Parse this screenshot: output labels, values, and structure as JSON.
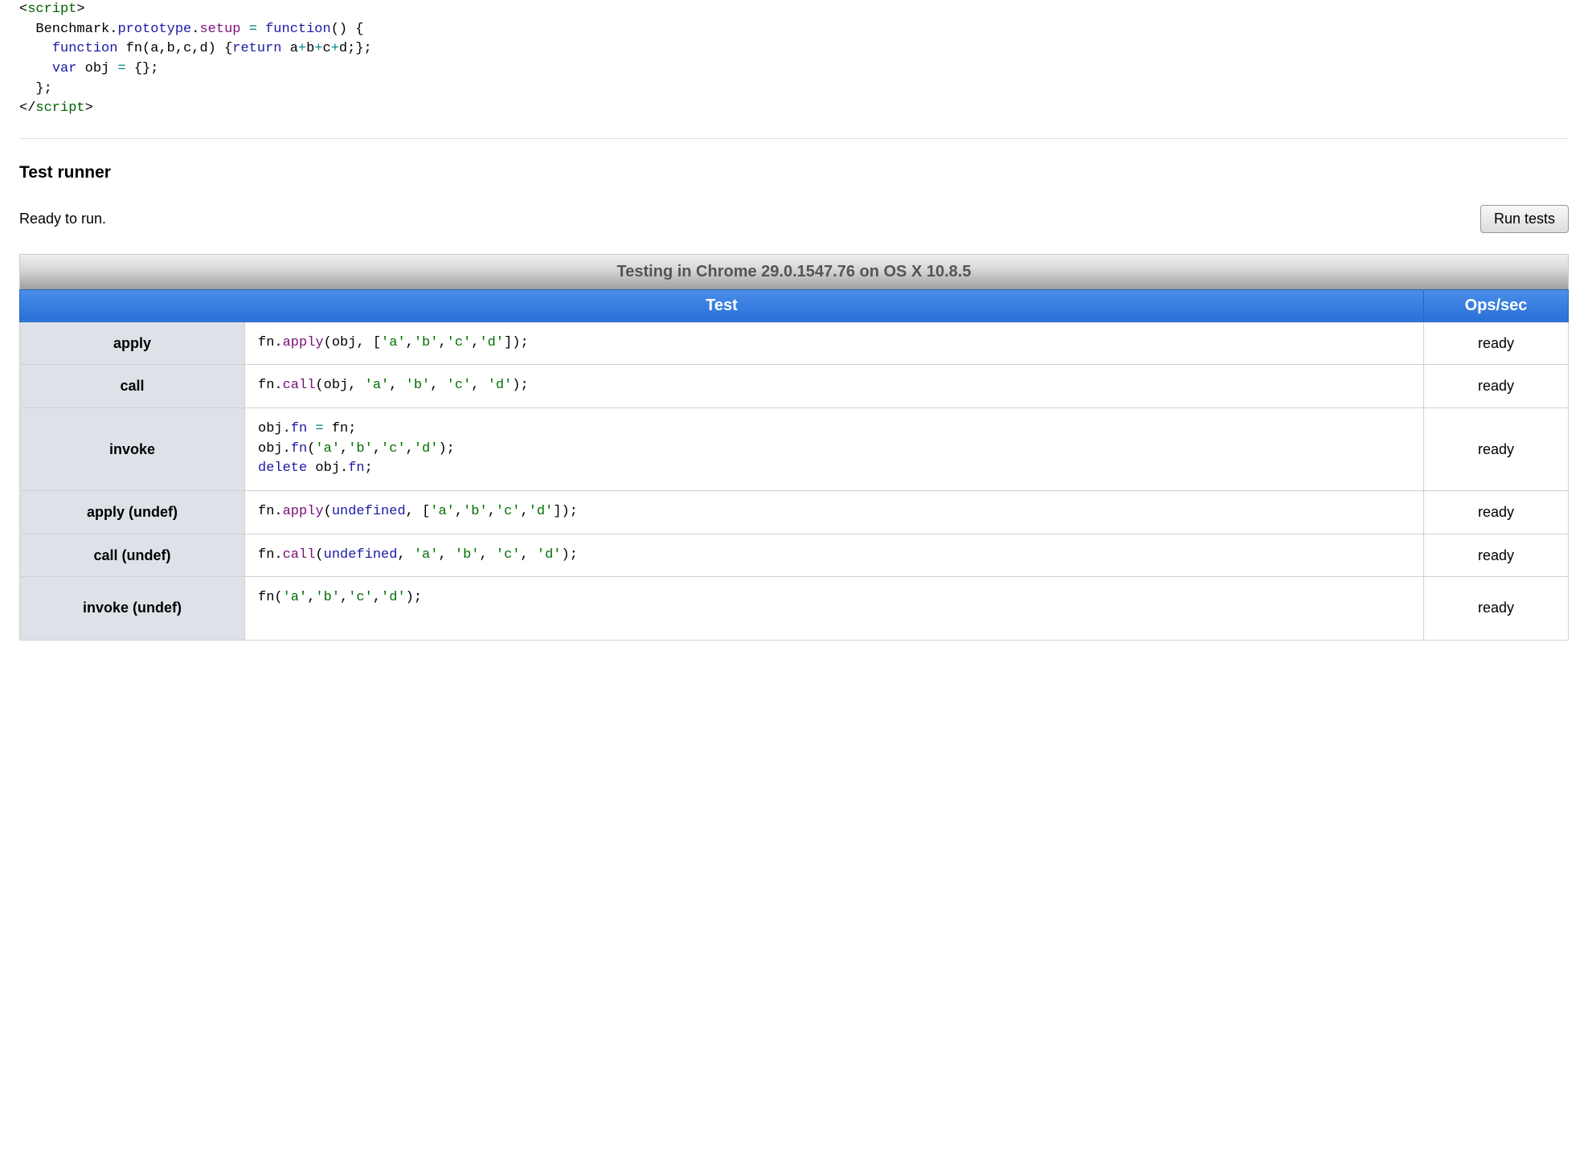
{
  "setup": {
    "tokens": [
      {
        "t": "punc",
        "v": "<"
      },
      {
        "t": "tag",
        "v": "script"
      },
      {
        "t": "punc",
        "v": ">"
      },
      {
        "t": "nl"
      },
      {
        "t": "sp",
        "v": "  "
      },
      {
        "t": "ident",
        "v": "Benchmark"
      },
      {
        "t": "punc",
        "v": "."
      },
      {
        "t": "member1",
        "v": "prototype"
      },
      {
        "t": "punc",
        "v": "."
      },
      {
        "t": "member2",
        "v": "setup"
      },
      {
        "t": "plain",
        "v": " "
      },
      {
        "t": "op",
        "v": "="
      },
      {
        "t": "plain",
        "v": " "
      },
      {
        "t": "kw",
        "v": "function"
      },
      {
        "t": "punc",
        "v": "()"
      },
      {
        "t": "plain",
        "v": " "
      },
      {
        "t": "punc",
        "v": "{"
      },
      {
        "t": "nl"
      },
      {
        "t": "sp",
        "v": "    "
      },
      {
        "t": "kw",
        "v": "function"
      },
      {
        "t": "plain",
        "v": " fn"
      },
      {
        "t": "punc",
        "v": "("
      },
      {
        "t": "plain",
        "v": "a"
      },
      {
        "t": "punc",
        "v": ","
      },
      {
        "t": "plain",
        "v": "b"
      },
      {
        "t": "punc",
        "v": ","
      },
      {
        "t": "plain",
        "v": "c"
      },
      {
        "t": "punc",
        "v": ","
      },
      {
        "t": "plain",
        "v": "d"
      },
      {
        "t": "punc",
        "v": ")"
      },
      {
        "t": "plain",
        "v": " "
      },
      {
        "t": "punc",
        "v": "{"
      },
      {
        "t": "kw",
        "v": "return"
      },
      {
        "t": "plain",
        "v": " a"
      },
      {
        "t": "op",
        "v": "+"
      },
      {
        "t": "plain",
        "v": "b"
      },
      {
        "t": "op",
        "v": "+"
      },
      {
        "t": "plain",
        "v": "c"
      },
      {
        "t": "op",
        "v": "+"
      },
      {
        "t": "plain",
        "v": "d"
      },
      {
        "t": "punc",
        "v": ";"
      },
      {
        "t": "punc",
        "v": "}"
      },
      {
        "t": "punc",
        "v": ";"
      },
      {
        "t": "nl"
      },
      {
        "t": "sp",
        "v": "    "
      },
      {
        "t": "kw",
        "v": "var"
      },
      {
        "t": "plain",
        "v": " obj "
      },
      {
        "t": "op",
        "v": "="
      },
      {
        "t": "plain",
        "v": " "
      },
      {
        "t": "punc",
        "v": "{};"
      },
      {
        "t": "nl"
      },
      {
        "t": "sp",
        "v": "  "
      },
      {
        "t": "punc",
        "v": "};"
      },
      {
        "t": "nl"
      },
      {
        "t": "punc",
        "v": "</"
      },
      {
        "t": "tag",
        "v": "script"
      },
      {
        "t": "punc",
        "v": ">"
      }
    ]
  },
  "section_heading": "Test runner",
  "status_text": "Ready to run.",
  "run_button_label": "Run tests",
  "table": {
    "caption": "Testing in Chrome 29.0.1547.76 on OS X 10.8.5",
    "columns": [
      "Test",
      "Ops/sec"
    ],
    "rows": [
      {
        "name": "apply",
        "ops": "ready",
        "tokens": [
          {
            "t": "plain",
            "v": "fn"
          },
          {
            "t": "punc",
            "v": "."
          },
          {
            "t": "member2",
            "v": "apply"
          },
          {
            "t": "punc",
            "v": "("
          },
          {
            "t": "plain",
            "v": "obj"
          },
          {
            "t": "punc",
            "v": ", "
          },
          {
            "t": "punc",
            "v": "["
          },
          {
            "t": "str",
            "v": "'a'"
          },
          {
            "t": "punc",
            "v": ","
          },
          {
            "t": "str",
            "v": "'b'"
          },
          {
            "t": "punc",
            "v": ","
          },
          {
            "t": "str",
            "v": "'c'"
          },
          {
            "t": "punc",
            "v": ","
          },
          {
            "t": "str",
            "v": "'d'"
          },
          {
            "t": "punc",
            "v": "]"
          },
          {
            "t": "punc",
            "v": ");"
          }
        ]
      },
      {
        "name": "call",
        "ops": "ready",
        "tokens": [
          {
            "t": "plain",
            "v": "fn"
          },
          {
            "t": "punc",
            "v": "."
          },
          {
            "t": "member2",
            "v": "call"
          },
          {
            "t": "punc",
            "v": "("
          },
          {
            "t": "plain",
            "v": "obj"
          },
          {
            "t": "punc",
            "v": ", "
          },
          {
            "t": "str",
            "v": "'a'"
          },
          {
            "t": "punc",
            "v": ", "
          },
          {
            "t": "str",
            "v": "'b'"
          },
          {
            "t": "punc",
            "v": ", "
          },
          {
            "t": "str",
            "v": "'c'"
          },
          {
            "t": "punc",
            "v": ", "
          },
          {
            "t": "str",
            "v": "'d'"
          },
          {
            "t": "punc",
            "v": ");"
          }
        ]
      },
      {
        "name": "invoke",
        "ops": "ready",
        "tokens": [
          {
            "t": "plain",
            "v": "obj"
          },
          {
            "t": "punc",
            "v": "."
          },
          {
            "t": "member1",
            "v": "fn"
          },
          {
            "t": "plain",
            "v": " "
          },
          {
            "t": "op",
            "v": "="
          },
          {
            "t": "plain",
            "v": " fn"
          },
          {
            "t": "punc",
            "v": ";"
          },
          {
            "t": "nl"
          },
          {
            "t": "plain",
            "v": "obj"
          },
          {
            "t": "punc",
            "v": "."
          },
          {
            "t": "member1",
            "v": "fn"
          },
          {
            "t": "punc",
            "v": "("
          },
          {
            "t": "str",
            "v": "'a'"
          },
          {
            "t": "punc",
            "v": ","
          },
          {
            "t": "str",
            "v": "'b'"
          },
          {
            "t": "punc",
            "v": ","
          },
          {
            "t": "str",
            "v": "'c'"
          },
          {
            "t": "punc",
            "v": ","
          },
          {
            "t": "str",
            "v": "'d'"
          },
          {
            "t": "punc",
            "v": ");"
          },
          {
            "t": "nl"
          },
          {
            "t": "kw",
            "v": "delete"
          },
          {
            "t": "plain",
            "v": " obj"
          },
          {
            "t": "punc",
            "v": "."
          },
          {
            "t": "member1",
            "v": "fn"
          },
          {
            "t": "punc",
            "v": ";"
          }
        ]
      },
      {
        "name": "apply (undef)",
        "ops": "ready",
        "tokens": [
          {
            "t": "plain",
            "v": "fn"
          },
          {
            "t": "punc",
            "v": "."
          },
          {
            "t": "member2",
            "v": "apply"
          },
          {
            "t": "punc",
            "v": "("
          },
          {
            "t": "kw",
            "v": "undefined"
          },
          {
            "t": "punc",
            "v": ", "
          },
          {
            "t": "punc",
            "v": "["
          },
          {
            "t": "str",
            "v": "'a'"
          },
          {
            "t": "punc",
            "v": ","
          },
          {
            "t": "str",
            "v": "'b'"
          },
          {
            "t": "punc",
            "v": ","
          },
          {
            "t": "str",
            "v": "'c'"
          },
          {
            "t": "punc",
            "v": ","
          },
          {
            "t": "str",
            "v": "'d'"
          },
          {
            "t": "punc",
            "v": "]"
          },
          {
            "t": "punc",
            "v": ");"
          }
        ]
      },
      {
        "name": "call (undef)",
        "ops": "ready",
        "tokens": [
          {
            "t": "plain",
            "v": "fn"
          },
          {
            "t": "punc",
            "v": "."
          },
          {
            "t": "member2",
            "v": "call"
          },
          {
            "t": "punc",
            "v": "("
          },
          {
            "t": "kw",
            "v": "undefined"
          },
          {
            "t": "punc",
            "v": ", "
          },
          {
            "t": "str",
            "v": "'a'"
          },
          {
            "t": "punc",
            "v": ", "
          },
          {
            "t": "str",
            "v": "'b'"
          },
          {
            "t": "punc",
            "v": ", "
          },
          {
            "t": "str",
            "v": "'c'"
          },
          {
            "t": "punc",
            "v": ", "
          },
          {
            "t": "str",
            "v": "'d'"
          },
          {
            "t": "punc",
            "v": ");"
          }
        ]
      },
      {
        "name": "invoke (undef)",
        "ops": "ready",
        "tokens": [
          {
            "t": "plain",
            "v": "fn"
          },
          {
            "t": "punc",
            "v": "("
          },
          {
            "t": "str",
            "v": "'a'"
          },
          {
            "t": "punc",
            "v": ","
          },
          {
            "t": "str",
            "v": "'b'"
          },
          {
            "t": "punc",
            "v": ","
          },
          {
            "t": "str",
            "v": "'c'"
          },
          {
            "t": "punc",
            "v": ","
          },
          {
            "t": "str",
            "v": "'d'"
          },
          {
            "t": "punc",
            "v": ");"
          },
          {
            "t": "nl"
          },
          {
            "t": "plain",
            "v": " "
          }
        ]
      }
    ]
  }
}
